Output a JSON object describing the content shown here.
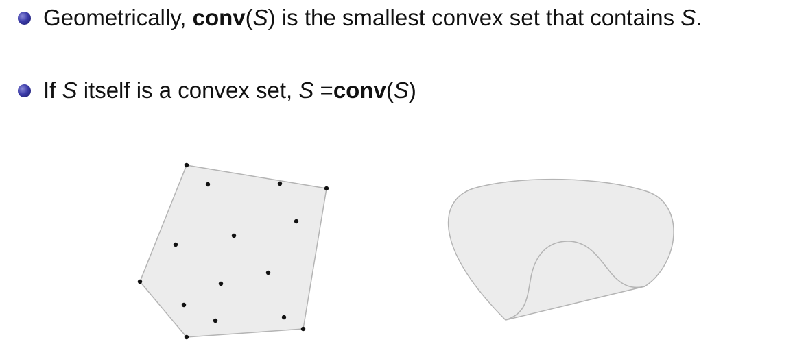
{
  "bullets": [
    {
      "t1": "Geometrically, ",
      "t2": "conv",
      "t3": "(",
      "t4": "S",
      "t5": ") is the smallest convex set that contains ",
      "t6": "S",
      "t7": "."
    },
    {
      "t1": "If ",
      "t2": "S",
      "t3": " itself is a convex set, ",
      "t4": "S",
      "t5": " =",
      "t6": "conv",
      "t7": "(",
      "t8": "S",
      "t9": ")"
    }
  ],
  "colors": {
    "bullet": "#2e2e9a",
    "shape_fill": "#ececec",
    "shape_stroke": "#b4b4b4",
    "point": "#111111"
  },
  "icons": [
    "bullet-ball-icon"
  ]
}
